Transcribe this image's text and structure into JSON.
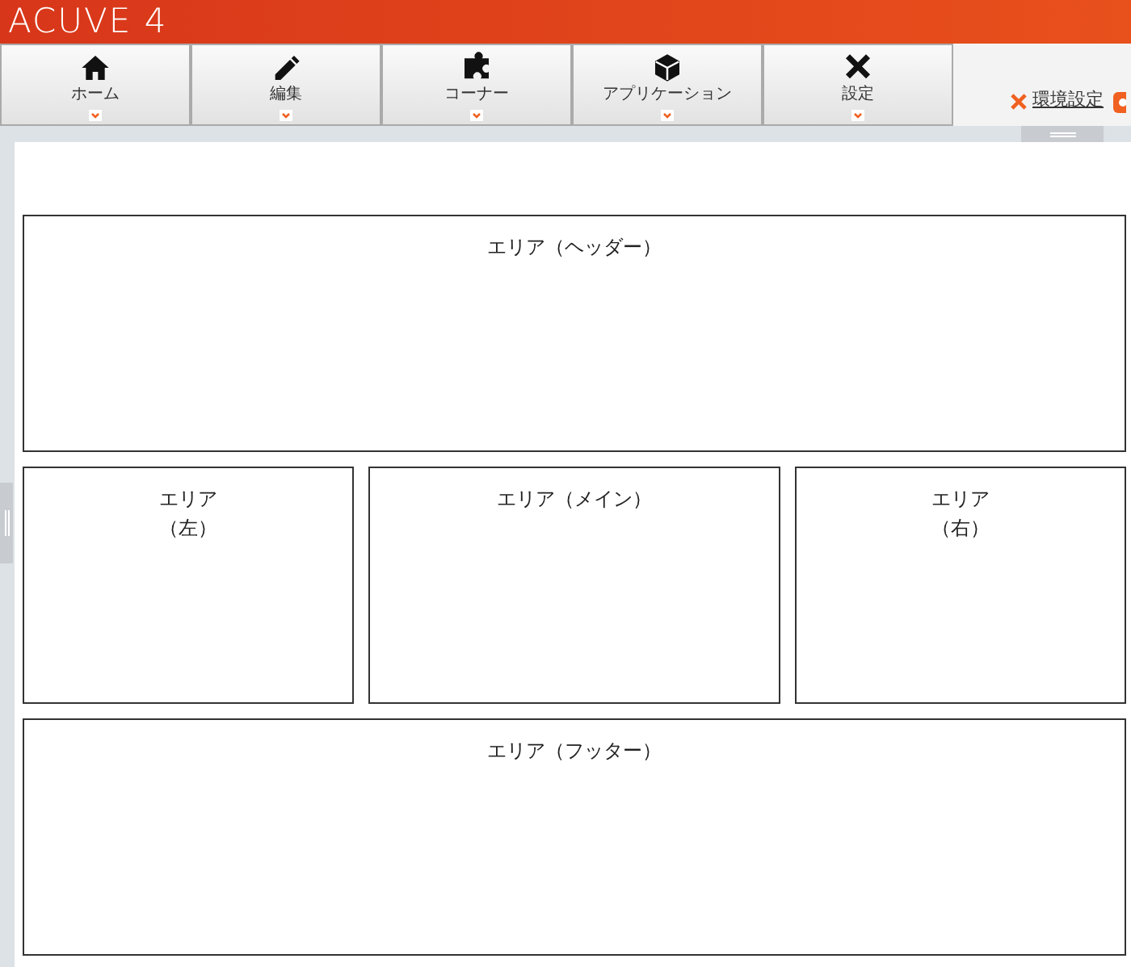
{
  "app": {
    "logo": "ACUVE 4"
  },
  "toolbar": [
    {
      "label": "ホーム"
    },
    {
      "label": "編集"
    },
    {
      "label": "コーナー"
    },
    {
      "label": "アプリケーション"
    },
    {
      "label": "設定"
    }
  ],
  "env_link": "環境設定",
  "areas": [
    {
      "label": "エリア（ヘッダー）"
    },
    {
      "label": "エリア（左）"
    },
    {
      "label": "エリア（メイン）"
    },
    {
      "label": "エリア（右）"
    },
    {
      "label": "エリア（フッター）"
    }
  ]
}
